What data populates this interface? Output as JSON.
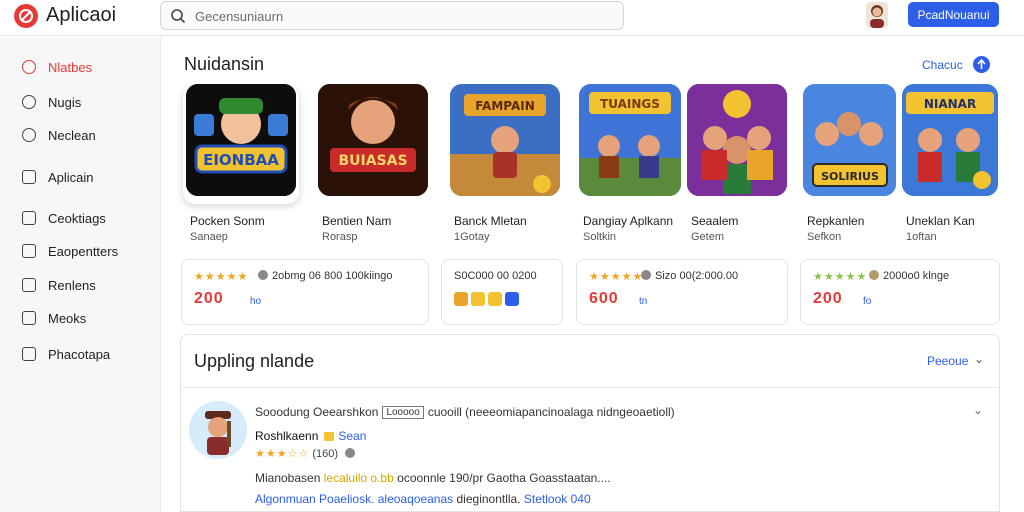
{
  "app": {
    "title": "Aplicaoi"
  },
  "search": {
    "placeholder": "Gecensuniaurn"
  },
  "header": {
    "primary_button": "PcadNouanui"
  },
  "sidebar": {
    "items": [
      {
        "label": "Nlatbes",
        "icon": "dashboard-icon",
        "active": true
      },
      {
        "label": "Nugis",
        "icon": "circle-icon",
        "active": false
      },
      {
        "label": "Neclean",
        "icon": "circle-icon",
        "active": false
      },
      {
        "label": "Aplicain",
        "icon": "document-icon",
        "active": false
      },
      {
        "label": "Ceoktiags",
        "icon": "folder-icon",
        "active": false
      },
      {
        "label": "Eaopentters",
        "icon": "grid-icon",
        "active": false
      },
      {
        "label": "Renlens",
        "icon": "list-icon",
        "active": false
      },
      {
        "label": "Meoks",
        "icon": "book-icon",
        "active": false
      },
      {
        "label": "Phacotapa",
        "icon": "message-icon",
        "active": false
      }
    ]
  },
  "featured": {
    "title": "Nuidansin",
    "action": "Chacuc",
    "games": [
      {
        "name": "Pocken Sonm",
        "sub": "Sanaep",
        "art": "EIONBAA"
      },
      {
        "name": "Bentien Nam",
        "sub": "Rorasp",
        "art": "BUIASAS"
      },
      {
        "name": "Banck Mletan",
        "sub": "1Gotay",
        "art": "FAMPAIN"
      },
      {
        "name": "Dangiay Aplkann",
        "sub": "Soltkin",
        "art": "TUAINGS"
      },
      {
        "name": "Seaalem",
        "sub": "Getem",
        "art": ""
      },
      {
        "name": "Repkanlen",
        "sub": "Sefkon",
        "art": "SOLIRIUS"
      },
      {
        "name": "Uneklan Kan",
        "sub": "1oftan",
        "art": "NIANAR"
      }
    ]
  },
  "ratings": [
    {
      "stars": "★★★★★",
      "meta": "2obmg 06 800 100kiingo",
      "score": "200",
      "unit": "ho"
    },
    {
      "stars": "",
      "meta": "S0C000 00 0200",
      "score": "",
      "unit": ""
    },
    {
      "stars": "★★★★★",
      "meta": "Sizo 00(2:000.00",
      "score": "600",
      "unit": "tn"
    },
    {
      "stars": "★★★★★",
      "meta": "2000o0 klnge",
      "score": "200",
      "unit": "fo"
    }
  ],
  "reviews": {
    "title": "Uppling nlande",
    "action": "Peeoue",
    "items": [
      {
        "head_pre": "Sooodung Oeearshkon",
        "tag": "Looooo",
        "head_post": "cuooill (neeeomiapancinoalaga nidngeoaetioll)",
        "author": "Roshlkaenn",
        "author_badge": "Sean",
        "stars": "★★★☆☆",
        "count": "(160)",
        "body_pre": "Mianobasen",
        "body_highlight": "lecaluilo o.bb",
        "body_post": "ocoonnle 190/pr Gaotha Goasstaatan....",
        "links_pre": "Algonmuan Poaeliosk. aleoaqoeanas",
        "links_dark": "dieginontlla.",
        "links_post": "Stetlook 040"
      }
    ]
  },
  "colors": {
    "accent": "#2c5ee8",
    "brand": "#e53935",
    "star": "#f2a41d"
  }
}
